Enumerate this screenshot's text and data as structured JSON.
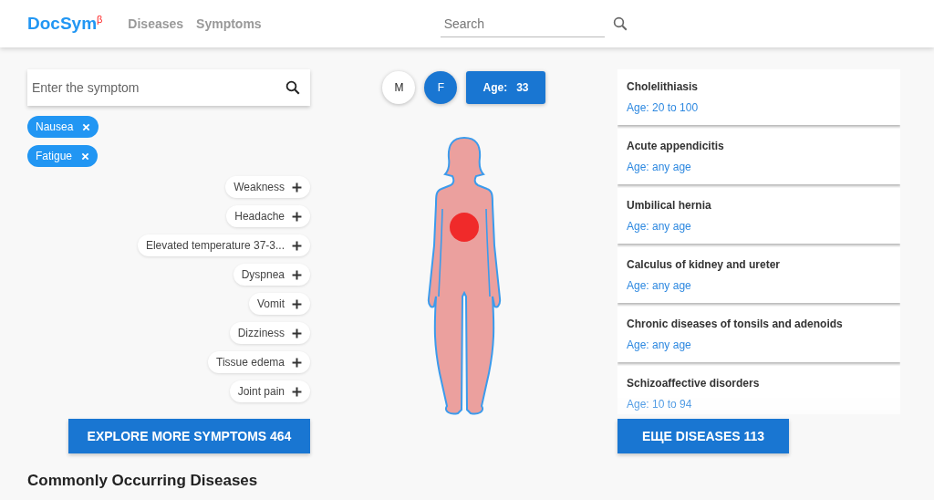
{
  "header": {
    "logo": "DocSym",
    "logo_mark": "β",
    "nav": [
      {
        "label": "Diseases"
      },
      {
        "label": "Symptoms"
      }
    ],
    "search": {
      "placeholder": "Search"
    }
  },
  "symptom_search": {
    "placeholder": "Enter the symptom"
  },
  "selected_symptoms": [
    {
      "label": "Nausea"
    },
    {
      "label": "Fatigue"
    }
  ],
  "suggested_symptoms": [
    {
      "label": "Weakness"
    },
    {
      "label": "Headache"
    },
    {
      "label": "Elevated temperature 37-3..."
    },
    {
      "label": "Dyspnea"
    },
    {
      "label": "Vomit"
    },
    {
      "label": "Dizziness"
    },
    {
      "label": "Tissue edema"
    },
    {
      "label": "Joint pain"
    }
  ],
  "explore_button": "EXPLORE MORE SYMPTOMS 464",
  "sex": [
    {
      "label": "M",
      "selected": false
    },
    {
      "label": "F",
      "selected": true
    }
  ],
  "age": {
    "label": "Age:",
    "value": "33"
  },
  "diseases": [
    {
      "name": "Cholelithiasis",
      "age": "Age: 20 to 100"
    },
    {
      "name": "Acute appendicitis",
      "age": "Age: any age"
    },
    {
      "name": "Umbilical hernia",
      "age": "Age: any age"
    },
    {
      "name": "Calculus of kidney and ureter",
      "age": "Age: any age"
    },
    {
      "name": "Chronic diseases of tonsils and adenoids",
      "age": "Age: any age"
    },
    {
      "name": "Schizoaffective disorders",
      "age": "Age: 10 to 94"
    }
  ],
  "more_diseases_button": "ЕЩЕ DISEASES 113",
  "section_title": "Commonly Occurring Diseases"
}
